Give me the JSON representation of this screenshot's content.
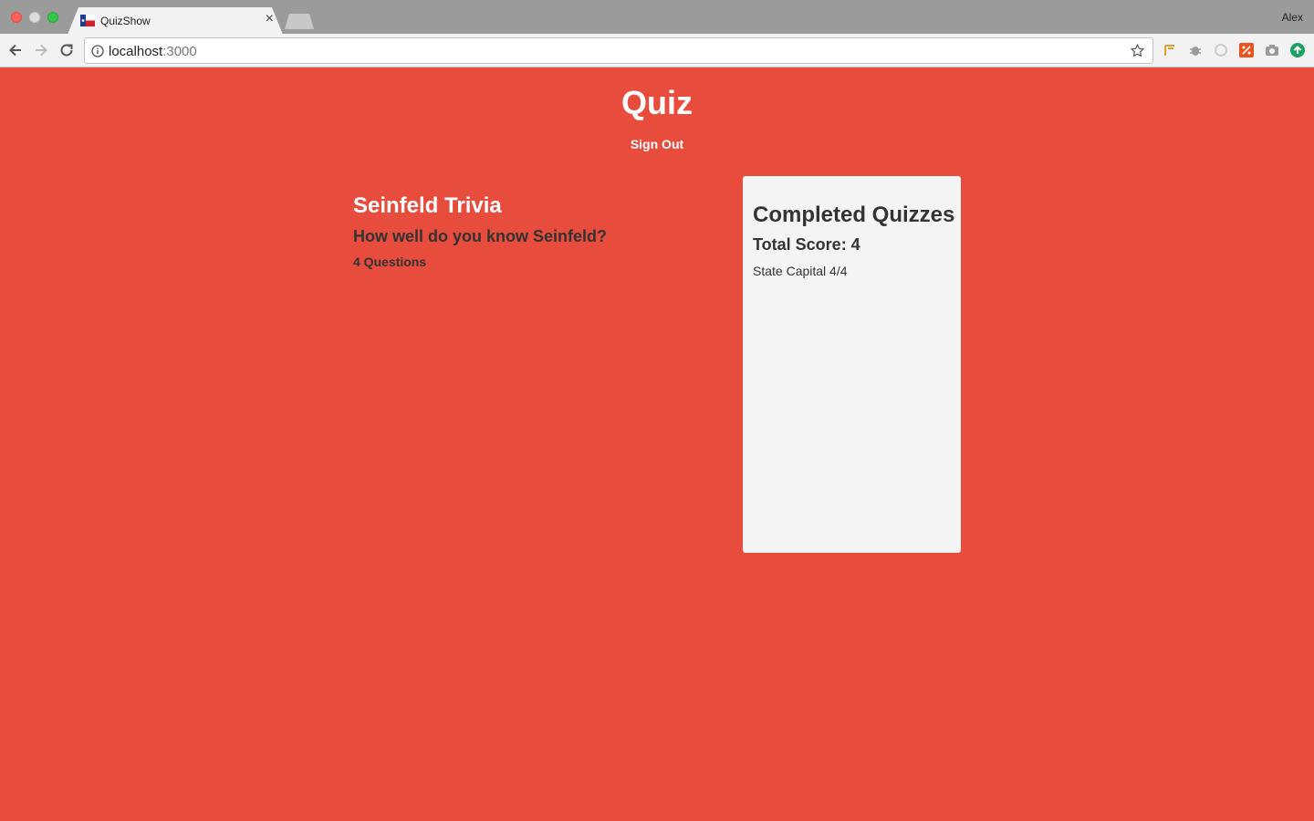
{
  "browser": {
    "tab_title": "QuizShow",
    "profile_name": "Alex",
    "url_host": "localhost",
    "url_port": ":3000"
  },
  "page": {
    "title": "Quiz",
    "sign_out": "Sign Out"
  },
  "quizzes": [
    {
      "title": "Seinfeld Trivia",
      "description": "How well do you know Seinfeld?",
      "question_count": "4 Questions"
    }
  ],
  "completed": {
    "heading": "Completed Quizzes",
    "total_score": "Total Score: 4",
    "results": [
      "State Capital 4/4"
    ]
  },
  "colors": {
    "background": "#e74c3c",
    "panel": "#f4f4f4",
    "text_dark": "#333333"
  }
}
